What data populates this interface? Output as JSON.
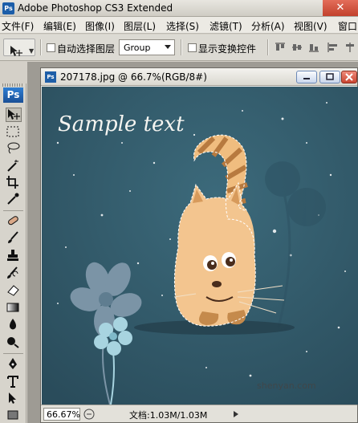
{
  "app": {
    "title": "Adobe Photoshop CS3 Extended",
    "logo": "Ps"
  },
  "menu": [
    {
      "label": "文件(F)"
    },
    {
      "label": "编辑(E)"
    },
    {
      "label": "图像(I)"
    },
    {
      "label": "图层(L)"
    },
    {
      "label": "选择(S)"
    },
    {
      "label": "滤镜(T)"
    },
    {
      "label": "分析(A)"
    },
    {
      "label": "视图(V)"
    },
    {
      "label": "窗口"
    }
  ],
  "options": {
    "auto_select_label": "自动选择图层",
    "auto_select_target": "Group",
    "show_transform_label": "显示变换控件"
  },
  "document": {
    "title": "207178.jpg @ 66.7%(RGB/8#)",
    "canvas_text": "Sample text",
    "zoom": "66.67%",
    "doc_info": "文档:1.03M/1.03M"
  },
  "watermark": "shenyan.com",
  "icons": [
    "move-tool-icon",
    "minimize-icon",
    "maximize-icon",
    "close-icon"
  ],
  "colors": {
    "canvas_bg": "#315767",
    "cat_body": "#f2c28c",
    "tail_stripe": "#b77a3f"
  }
}
